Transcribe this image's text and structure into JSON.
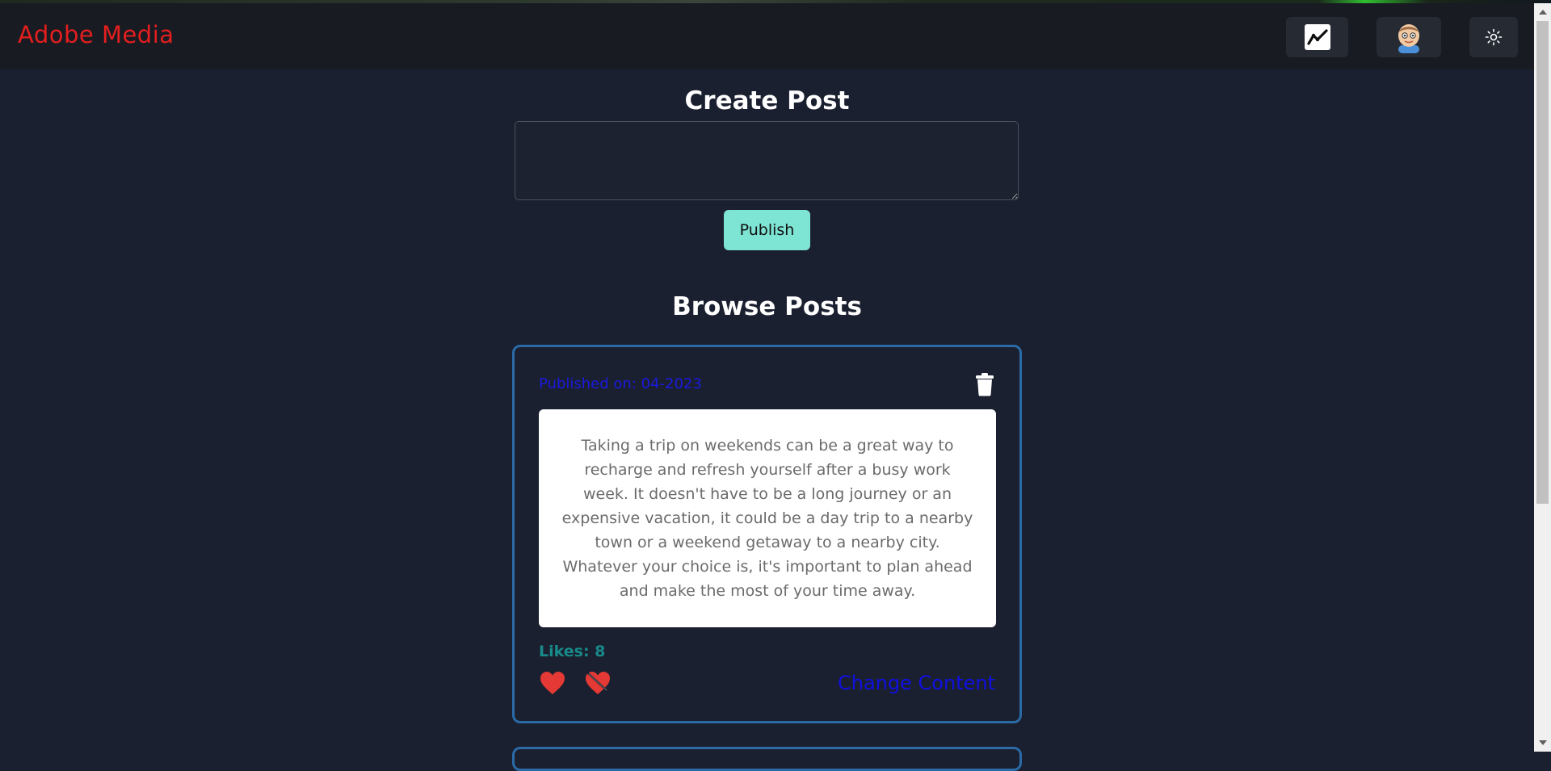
{
  "app": {
    "brand": "Adobe Media"
  },
  "navbar": {
    "analytics_icon": "line-chart-icon",
    "profile_icon": "avatar",
    "theme_icon": "sun-icon"
  },
  "create": {
    "title": "Create Post",
    "textarea_value": "",
    "publish_label": "Publish"
  },
  "browse": {
    "title": "Browse Posts",
    "posts": [
      {
        "published": "Published on: 04-2023",
        "content": "Taking a trip on weekends can be a great way to recharge and refresh yourself after a busy work week. It doesn't have to be a long journey or an expensive vacation, it could be a day trip to a nearby town or a weekend getaway to a nearby city. Whatever your choice is, it's important to plan ahead and make the most of your time away.",
        "likes": "Likes: 8",
        "change_label": "Change Content"
      }
    ]
  },
  "colors": {
    "background": "#1b2030",
    "navbar": "#181b22",
    "brand": "#e41e1e",
    "card_border": "#2a6aa6",
    "publish": "#7ee4d4",
    "published_text": "#1a1adb",
    "likes_text": "#188a8a",
    "heart": "#e53935"
  }
}
